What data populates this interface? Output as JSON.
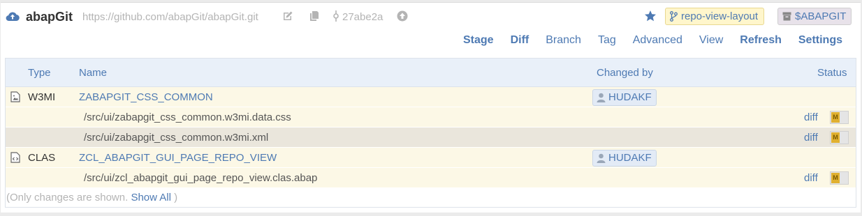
{
  "repo": {
    "name": "abapGit",
    "url": "https://github.com/abapGit/abapGit.git",
    "commit": "27abe2a",
    "branch": "repo-view-layout",
    "package": "$ABAPGIT"
  },
  "toolbar": {
    "stage": "Stage",
    "diff": "Diff",
    "branch": "Branch",
    "tag": "Tag",
    "advanced": "Advanced",
    "view": "View",
    "refresh": "Refresh",
    "settings": "Settings"
  },
  "table": {
    "headers": {
      "type": "Type",
      "name": "Name",
      "changed_by": "Changed by",
      "status": "Status"
    },
    "objects": [
      {
        "type": "W3MI",
        "name": "ZABAPGIT_CSS_COMMON",
        "changed_by": "HUDAKF",
        "files": [
          {
            "path": "/src/ui/zabapgit_css_common.w3mi.data.css",
            "diff": "diff",
            "status": "M"
          },
          {
            "path": "/src/ui/zabapgit_css_common.w3mi.xml",
            "diff": "diff",
            "status": "M"
          }
        ]
      },
      {
        "type": "CLAS",
        "name": "ZCL_ABAPGIT_GUI_PAGE_REPO_VIEW",
        "changed_by": "HUDAKF",
        "files": [
          {
            "path": "/src/ui/zcl_abapgit_gui_page_repo_view.clas.abap",
            "diff": "diff",
            "status": "M"
          }
        ]
      }
    ]
  },
  "footer": {
    "prefix": "(Only changes are shown.",
    "show_all": "Show All",
    "suffix": ")"
  },
  "colors": {
    "link": "#4e7ab3",
    "object_row_bg": "#fcf8e6",
    "alt_row_bg": "#eae6dc",
    "header_bg": "#e9f0f9",
    "branch_badge_bg": "#fff6cc",
    "status_modified": "#e0b030"
  },
  "icons": {
    "upload": "cloud-upload-icon",
    "edit": "edit-icon",
    "copy": "copy-icon",
    "commit": "commit-icon",
    "sync": "circle-up-icon",
    "favorite": "star-icon",
    "branch": "code-branch-icon",
    "package": "box-icon",
    "user": "user-icon",
    "file": "file-icon"
  }
}
